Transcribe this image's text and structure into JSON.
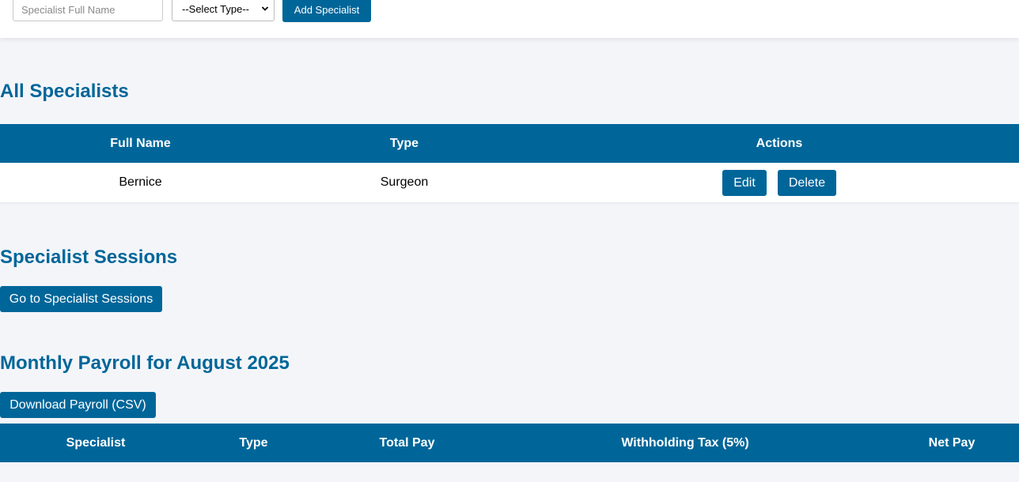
{
  "add_form": {
    "name_placeholder": "Specialist Full Name",
    "type_select_value": "--Select Type--",
    "add_button_label": "Add Specialist"
  },
  "all_specialists": {
    "heading": "All Specialists",
    "columns": [
      "Full Name",
      "Type",
      "Actions"
    ],
    "rows": [
      {
        "full_name": "Bernice",
        "type": "Surgeon",
        "edit_label": "Edit",
        "delete_label": "Delete"
      }
    ]
  },
  "sessions": {
    "heading": "Specialist Sessions",
    "button_label": "Go to Specialist Sessions"
  },
  "payroll": {
    "heading": "Monthly Payroll for August 2025",
    "download_label": "Download Payroll (CSV)",
    "columns": [
      "Specialist",
      "Type",
      "Total Pay",
      "Withholding Tax (5%)",
      "Net Pay"
    ]
  },
  "colors": {
    "accent": "#006699",
    "page_background": "#f3f5f9",
    "card_background": "#ffffff"
  }
}
